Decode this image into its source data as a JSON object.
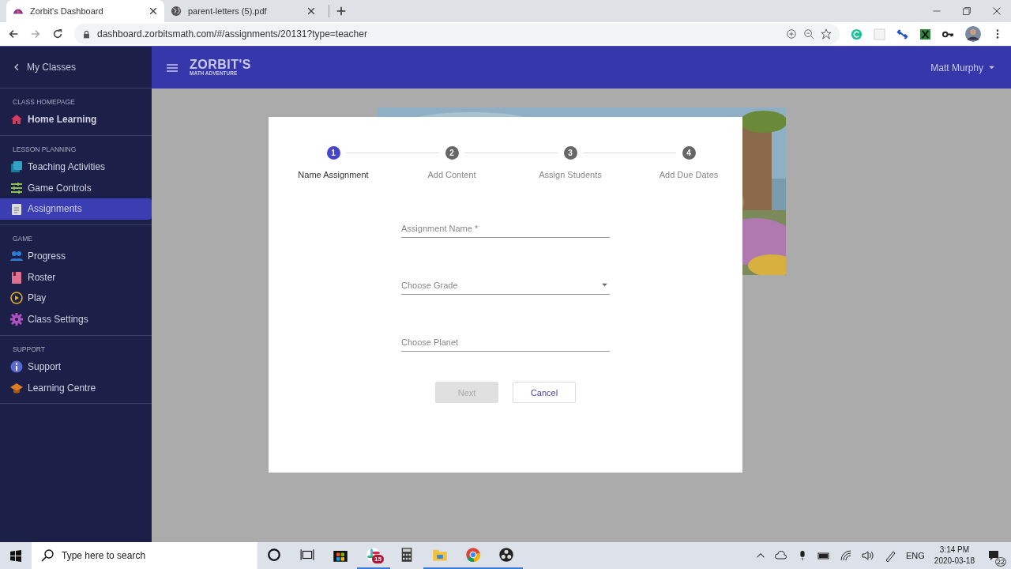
{
  "browser": {
    "tabs": [
      {
        "title": "Zorbit's Dashboard",
        "selected": true
      },
      {
        "title": "parent-letters (5).pdf",
        "selected": false
      }
    ],
    "url": "dashboard.zorbitsmath.com/#/assignments/20131?type=teacher"
  },
  "sidebar": {
    "back": "My Classes",
    "sections": [
      {
        "heading": "CLASS HOMEPAGE",
        "items": [
          {
            "label": "Home Learning",
            "selected": false
          }
        ]
      },
      {
        "heading": "LESSON PLANNING",
        "items": [
          {
            "label": "Teaching Activities",
            "selected": false
          },
          {
            "label": "Game Controls",
            "selected": false
          },
          {
            "label": "Assignments",
            "selected": true
          }
        ]
      },
      {
        "heading": "GAME",
        "items": [
          {
            "label": "Progress",
            "selected": false
          },
          {
            "label": "Roster",
            "selected": false
          },
          {
            "label": "Play",
            "selected": false
          },
          {
            "label": "Class Settings",
            "selected": false
          }
        ]
      },
      {
        "heading": "SUPPORT",
        "items": [
          {
            "label": "Support",
            "selected": false
          },
          {
            "label": "Learning Centre",
            "selected": false
          }
        ]
      }
    ]
  },
  "header": {
    "brand_top": "ZORBIT'S",
    "brand_bottom": "MATH ADVENTURE",
    "user": "Matt Murphy"
  },
  "dialog": {
    "steps": [
      {
        "number": "1",
        "label": "Name Assignment",
        "selected": true
      },
      {
        "number": "2",
        "label": "Add Content",
        "selected": false
      },
      {
        "number": "3",
        "label": "Assign Students",
        "selected": false
      },
      {
        "number": "4",
        "label": "Add Due Dates",
        "selected": false
      }
    ],
    "fields": [
      {
        "placeholder": "Assignment Name *",
        "kind": "text"
      },
      {
        "placeholder": "Choose Grade",
        "kind": "select"
      },
      {
        "placeholder": "Choose Planet",
        "kind": "text"
      }
    ],
    "next": {
      "label": "Next",
      "disabled": true
    },
    "cancel": {
      "label": "Cancel"
    }
  },
  "taskbar": {
    "search_placeholder": "Type here to search",
    "apps": [
      {
        "running": false
      },
      {
        "running": false
      },
      {
        "running": false
      },
      {
        "running": true,
        "badge": "15"
      },
      {
        "running": false
      },
      {
        "running": true
      },
      {
        "running": true
      },
      {
        "running": true
      }
    ],
    "language": "ENG",
    "time": "3:14 PM",
    "date": "2020-03-18",
    "notifications": "22"
  }
}
